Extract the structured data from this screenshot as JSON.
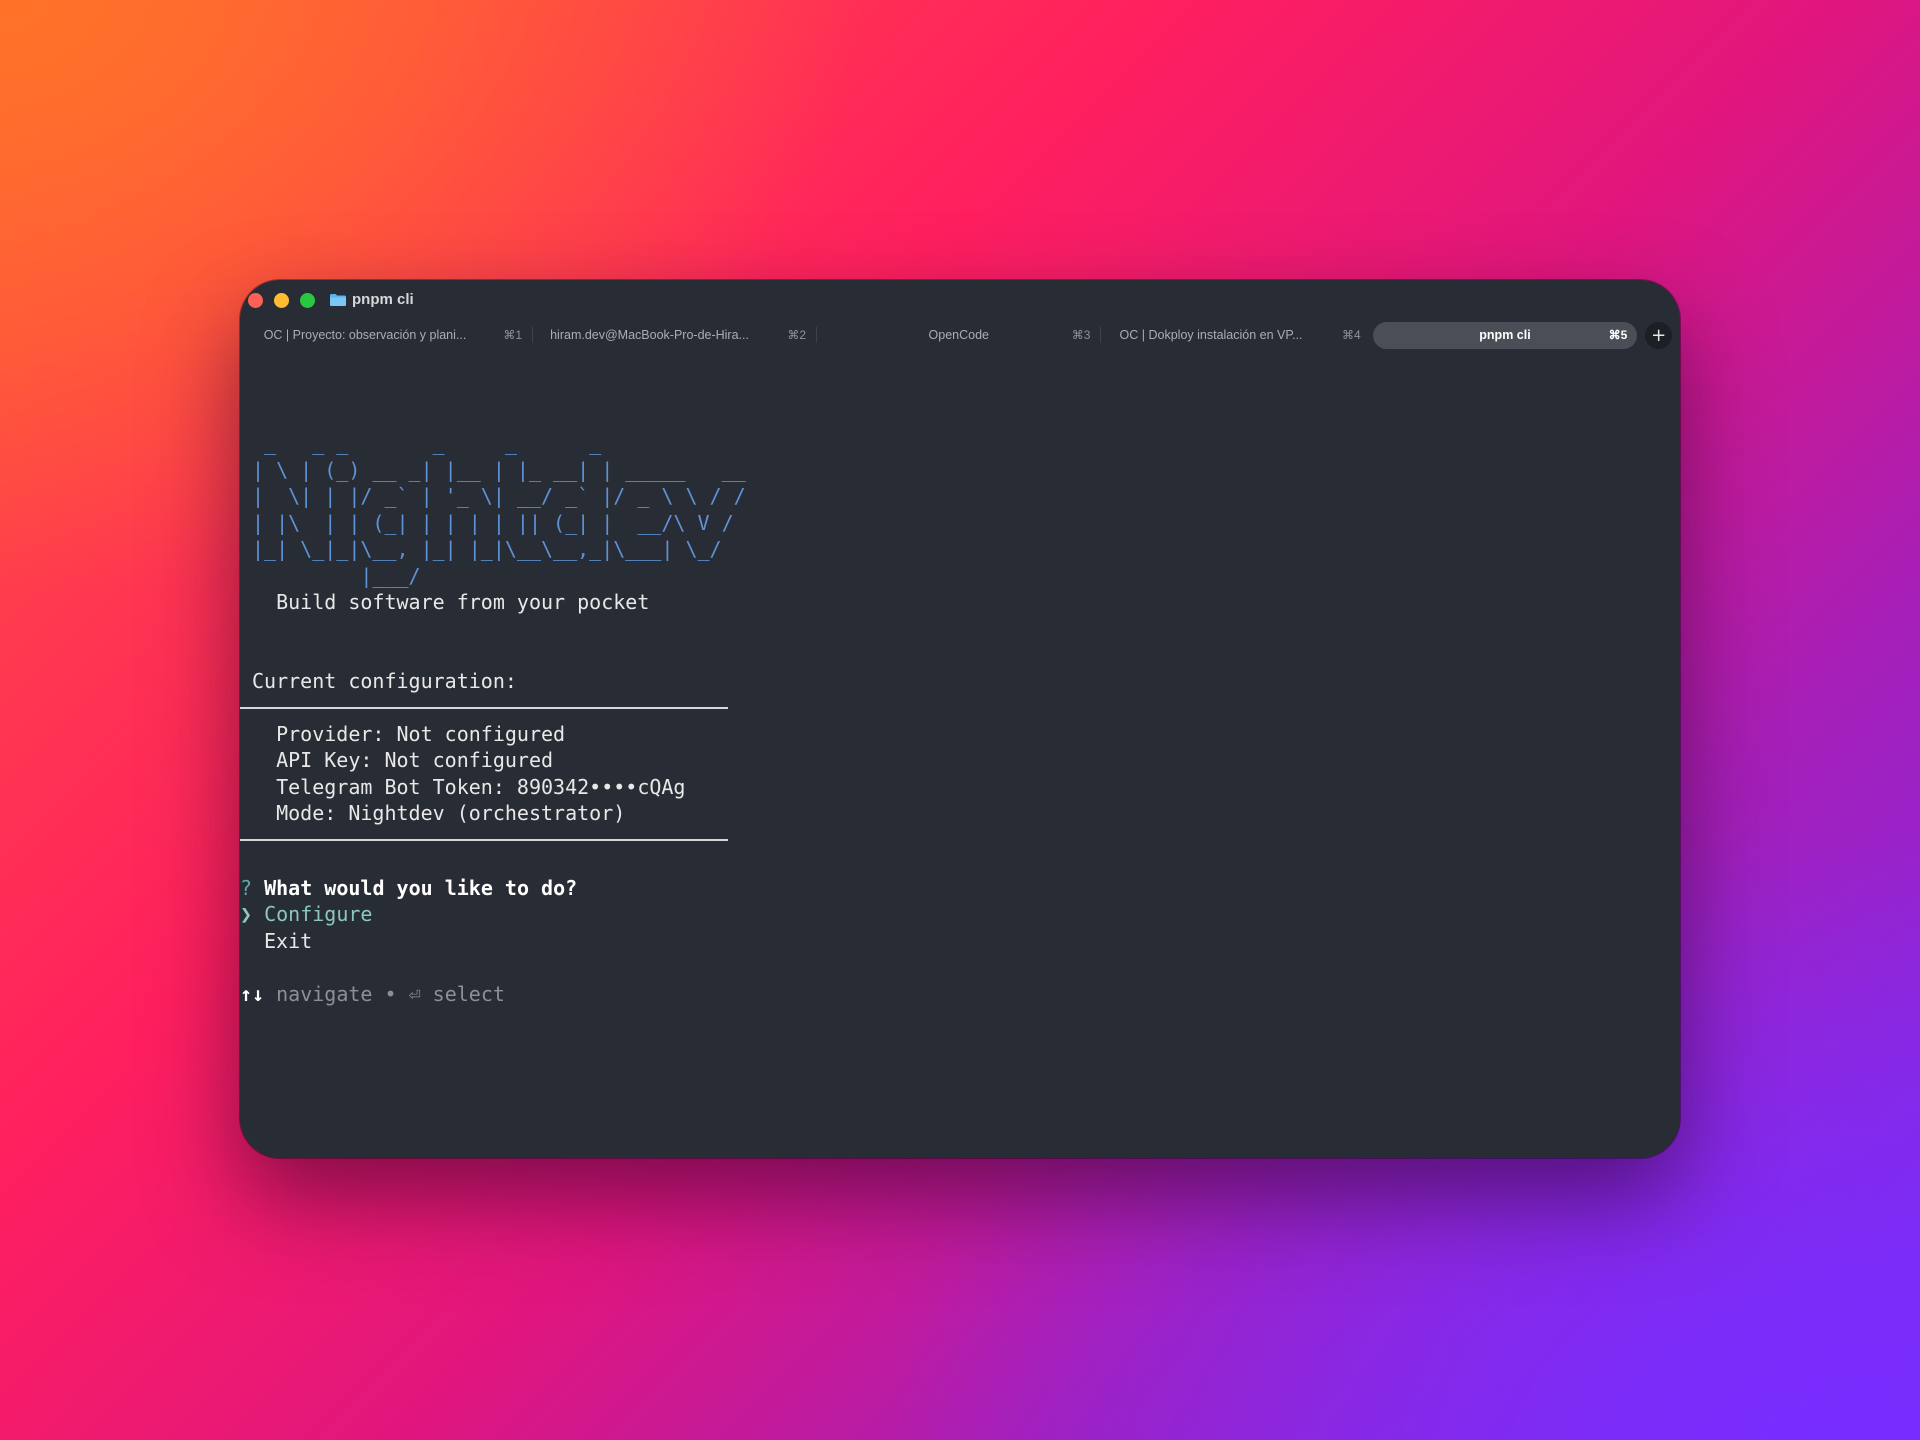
{
  "window": {
    "title": "pnpm cli",
    "folder_icon": "folder-icon"
  },
  "tabs": [
    {
      "label": "OC | Proyecto: observación y plani...",
      "shortcut": "⌘1",
      "active": false
    },
    {
      "label": "hiram.dev@MacBook-Pro-de-Hira...",
      "shortcut": "⌘2",
      "active": false
    },
    {
      "label": "OpenCode",
      "shortcut": "⌘3",
      "active": false
    },
    {
      "label": "OC | Dokploy instalación en VP...",
      "shortcut": "⌘4",
      "active": false
    },
    {
      "label": "pnpm cli",
      "shortcut": "⌘5",
      "active": true
    }
  ],
  "new_tab_label": "+",
  "terminal": {
    "ascii_art": [
      " _   _ _       _     _      _",
      "| \\ | (_) __ _| |__ | |_ __| | _____   __",
      "|  \\| | |/ _` | '_ \\| __/ _` |/ _ \\ \\ / /",
      "| |\\  | | (_| | | | | || (_| |  __/\\ V /",
      "|_| \\_|_|\\__, |_| |_|\\__\\__,_|\\___| \\_/",
      "         |___/"
    ],
    "tagline": "  Build software from your pocket",
    "config_heading": "Current configuration:",
    "config_lines": [
      "  Provider: Not configured",
      "  API Key: Not configured",
      "  Telegram Bot Token: 890342••••cQAg",
      "  Mode: Nightdev (orchestrator)"
    ],
    "prompt_mark": "?",
    "prompt_question": " What would you like to do?",
    "pointer": "❯",
    "options": [
      "Configure",
      "Exit"
    ],
    "hint_arrows": "↑↓",
    "hint_text": " navigate • ⏎ select"
  }
}
